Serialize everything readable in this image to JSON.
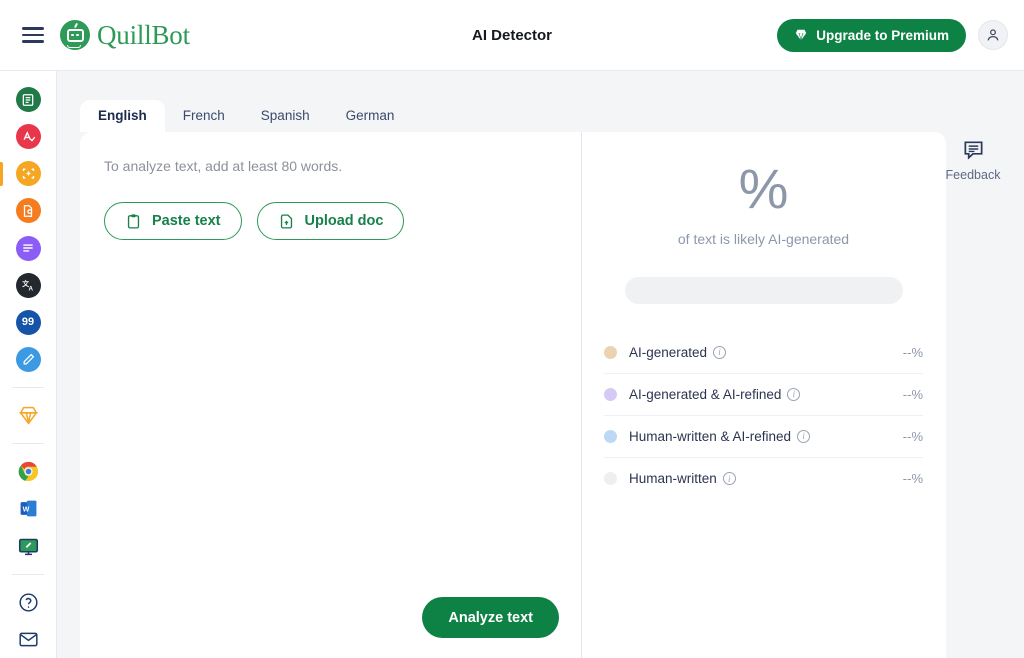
{
  "header": {
    "menu_icon": "hamburger-menu-icon",
    "brand_name": "QuillBot",
    "title": "AI Detector",
    "upgrade_label": "Upgrade to Premium",
    "upgrade_icon": "diamond-icon",
    "upgrade_color": "#0e8145",
    "account_icon": "user-account-icon"
  },
  "sidebar": {
    "items": [
      {
        "name": "paraphraser",
        "glyph": "✎",
        "color": "#1f7a47",
        "active": false
      },
      {
        "name": "grammar-checker",
        "glyph": "A",
        "color": "#e8374a",
        "active": false
      },
      {
        "name": "ai-detector",
        "glyph": "✦",
        "color": "#f5a623",
        "active": true
      },
      {
        "name": "plagiarism-checker",
        "glyph": "◔",
        "color": "#f57c1f",
        "active": false
      },
      {
        "name": "summarizer",
        "glyph": "≡",
        "color": "#8b5cf6",
        "active": false
      },
      {
        "name": "translator",
        "glyph": "A",
        "color": "#23272e",
        "active": false
      },
      {
        "name": "citation-generator",
        "glyph": "99",
        "color": "#1554a8",
        "active": false
      },
      {
        "name": "co-writer",
        "glyph": "✎",
        "color": "#3b9ae1",
        "active": false
      }
    ],
    "premium_icon": "diamond-premium-icon",
    "extensions": [
      {
        "name": "chrome-extension",
        "icon": "chrome-icon"
      },
      {
        "name": "word-addin",
        "icon": "word-icon"
      },
      {
        "name": "desktop-app",
        "icon": "monitor-icon"
      }
    ],
    "utilities": [
      {
        "name": "help",
        "icon": "question-circle-icon"
      },
      {
        "name": "contact",
        "icon": "mail-icon"
      }
    ],
    "active_indicator_color": "#f5a623"
  },
  "tabs": [
    {
      "label": "English",
      "active": true
    },
    {
      "label": "French",
      "active": false
    },
    {
      "label": "Spanish",
      "active": false
    },
    {
      "label": "German",
      "active": false
    }
  ],
  "editor": {
    "hint": "To analyze text, add at least 80 words.",
    "paste_label": "Paste text",
    "paste_icon": "clipboard-icon",
    "upload_label": "Upload doc",
    "upload_icon": "document-upload-icon",
    "analyze_label": "Analyze text"
  },
  "results": {
    "percent_value": "%",
    "caption": "of text is likely AI-generated",
    "legend": [
      {
        "label": "AI-generated",
        "value": "--%",
        "color": "#ebd3b0",
        "info_icon": "info-icon"
      },
      {
        "label": "AI-generated & AI-refined",
        "value": "--%",
        "color": "#d7c9f5",
        "info_icon": "info-icon"
      },
      {
        "label": "Human-written & AI-refined",
        "value": "--%",
        "color": "#bdd8f5",
        "info_icon": "info-icon"
      },
      {
        "label": "Human-written",
        "value": "--%",
        "color": "#efefef",
        "info_icon": "info-icon"
      }
    ]
  },
  "feedback": {
    "label": "Feedback",
    "icon": "comment-icon"
  }
}
